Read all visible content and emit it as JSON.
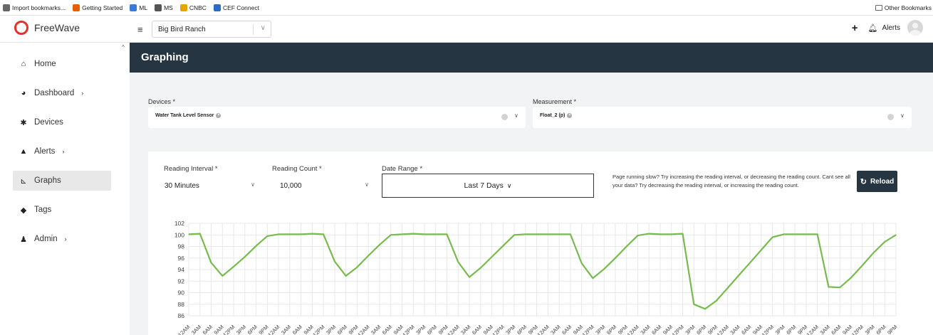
{
  "bookmarks": {
    "items": [
      {
        "label": "Import bookmarks...",
        "icon": "import-icon",
        "color": "#666666"
      },
      {
        "label": "Getting Started",
        "icon": "firefox-icon",
        "color": "#e66000"
      },
      {
        "label": "ML",
        "icon": "ml-icon",
        "color": "#3a7bd5"
      },
      {
        "label": "MS",
        "icon": "globe-icon",
        "color": "#555555"
      },
      {
        "label": "CNBC",
        "icon": "cnbc-icon",
        "color": "#e8a400"
      },
      {
        "label": "CEF Connect",
        "icon": "cef-icon",
        "color": "#2a6bc6"
      }
    ],
    "other": "Other Bookmarks"
  },
  "topbar": {
    "logo_text": "FreeWave",
    "org_select": "Big Bird Ranch",
    "alerts_label": "Alerts",
    "brand_color": "#e8302a"
  },
  "sidebar": {
    "items": [
      {
        "label": "Home",
        "icon": "home-icon",
        "glyph": "⌂"
      },
      {
        "label": "Dashboard",
        "icon": "dashboard-icon",
        "glyph": "◕",
        "chevron": "›"
      },
      {
        "label": "Devices",
        "icon": "devices-icon",
        "glyph": "✱"
      },
      {
        "label": "Alerts",
        "icon": "alert-icon",
        "glyph": "▲",
        "chevron": "›"
      },
      {
        "label": "Graphs",
        "icon": "graph-icon",
        "glyph": "⊾",
        "active": true
      },
      {
        "label": "Tags",
        "icon": "tag-icon",
        "glyph": "◆"
      },
      {
        "label": "Admin",
        "icon": "admin-icon",
        "glyph": "♟",
        "chevron": "›"
      }
    ]
  },
  "main": {
    "title": "Graphing",
    "devices": {
      "label": "Devices *",
      "chip": "Water Tank Level Sensor"
    },
    "measurement": {
      "label": "Measurement *",
      "chip": "Float_2 (p)"
    },
    "reading_interval": {
      "label": "Reading Interval *",
      "value": "30 Minutes"
    },
    "reading_count": {
      "label": "Reading Count *",
      "value": "10,000"
    },
    "date_range": {
      "label": "Date Range *",
      "value": "Last 7 Days"
    },
    "hint": "Page running slow? Try increasing the reading interval, or decreasing the reading count. Cant see all your data? Try decreasing the reading interval, or increasing the reading count.",
    "reload_label": "Reload"
  },
  "chart_data": {
    "type": "line",
    "title": "",
    "xlabel": "",
    "ylabel": "",
    "ylim": [
      86,
      102
    ],
    "yticks": [
      86,
      88,
      90,
      92,
      94,
      96,
      98,
      100,
      102
    ],
    "x_tick_labels": [
      "12AM",
      "3AM",
      "6AM",
      "9AM",
      "12PM",
      "3PM",
      "6PM",
      "9PM",
      "12AM",
      "3AM",
      "6AM",
      "9AM",
      "12PM",
      "3PM",
      "6PM",
      "9PM",
      "12AM",
      "3AM",
      "6AM",
      "9AM",
      "12PM",
      "3PM",
      "6PM",
      "9PM",
      "12AM",
      "3AM",
      "6AM",
      "9AM",
      "12PM",
      "3PM",
      "6PM",
      "9PM",
      "12AM",
      "3AM",
      "6AM",
      "9AM",
      "12PM",
      "3PM",
      "6PM",
      "9PM",
      "12AM",
      "3AM",
      "6AM",
      "9AM",
      "12PM",
      "3PM",
      "6PM",
      "9PM",
      "12AM",
      "3AM",
      "6AM",
      "9AM",
      "12PM",
      "3PM",
      "6PM",
      "9PM",
      "12AM",
      "3AM",
      "6AM",
      "9AM",
      "12PM",
      "3PM",
      "6PM",
      "9PM"
    ],
    "x_unit": "hours since first tick",
    "grid": true,
    "line_color": "#78bb4d",
    "series": [
      {
        "x": [
          0,
          3,
          6,
          9,
          12,
          15,
          18,
          21,
          24,
          27,
          30,
          33,
          36,
          39,
          42,
          45,
          48,
          51,
          54,
          57,
          60,
          63,
          66,
          69,
          72,
          75,
          78,
          81,
          84,
          87,
          90,
          93,
          96,
          99,
          102,
          105,
          108,
          111,
          114,
          117,
          120,
          123,
          126,
          129,
          132,
          135,
          138,
          141,
          144,
          147,
          150,
          153,
          156,
          159,
          162,
          165,
          168,
          171,
          174,
          177,
          180,
          183,
          186,
          189
        ],
        "values": [
          100.1,
          100.2,
          95.2,
          92.9,
          94.5,
          96.2,
          98.1,
          99.8,
          100.1,
          100.1,
          100.1,
          100.2,
          100.1,
          95.4,
          92.9,
          94.4,
          96.4,
          98.3,
          100.0,
          100.1,
          100.2,
          100.1,
          100.1,
          100.1,
          95.3,
          92.7,
          94.3,
          96.2,
          98.1,
          100.0,
          100.1,
          100.1,
          100.1,
          100.1,
          100.1,
          95.1,
          92.5,
          94.1,
          96.0,
          98.0,
          99.9,
          100.2,
          100.1,
          100.1,
          100.2,
          88.0,
          87.2,
          88.6,
          90.8,
          93.0,
          95.2,
          97.4,
          99.6,
          100.1,
          100.1,
          100.1,
          100.1,
          91.0,
          90.9,
          92.6,
          94.7,
          96.9,
          98.8,
          100.0
        ]
      }
    ]
  }
}
